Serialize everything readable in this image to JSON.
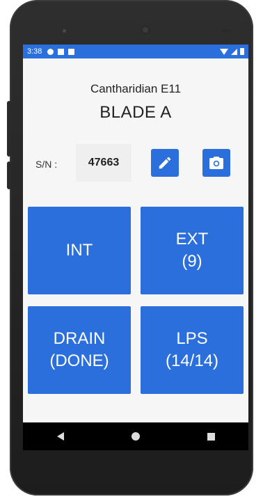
{
  "status_bar": {
    "time": "3:38"
  },
  "header": {
    "model": "Cantharidian E11",
    "blade": "BLADE A"
  },
  "serial": {
    "label": "S/N :",
    "value": "47663"
  },
  "tiles": [
    {
      "line1": "INT",
      "line2": ""
    },
    {
      "line1": "EXT",
      "line2": "(9)"
    },
    {
      "line1": "DRAIN",
      "line2": "(DONE)"
    },
    {
      "line1": "LPS",
      "line2": "(14/14)"
    }
  ],
  "colors": {
    "accent": "#2a6fdb",
    "background": "#f6f6f6",
    "serial_box": "#efefef"
  },
  "icons": {
    "edit": "pencil-icon",
    "camera": "camera-icon"
  }
}
